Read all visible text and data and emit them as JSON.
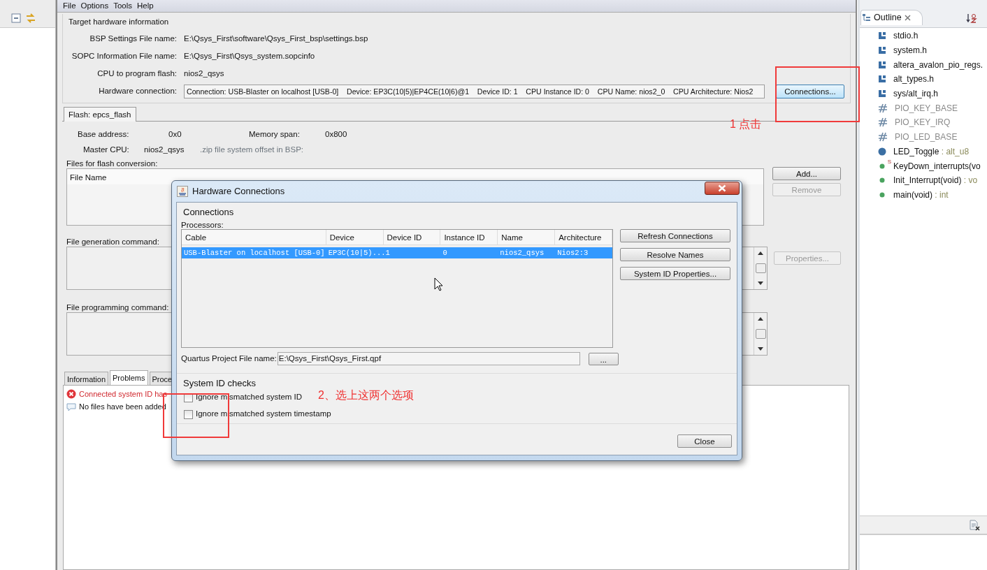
{
  "menu": [
    "File",
    "Options",
    "Tools",
    "Help"
  ],
  "target_hardware": {
    "title": "Target hardware information",
    "fields": [
      {
        "label": "BSP Settings File name:",
        "value": "E:\\Qsys_First\\software\\Qsys_First_bsp\\settings.bsp"
      },
      {
        "label": "SOPC Information File name:",
        "value": "E:\\Qsys_First\\Qsys_system.sopcinfo"
      },
      {
        "label": "CPU to program flash:",
        "value": "nios2_qsys"
      }
    ],
    "connection_label": "Hardware connection:",
    "connection_value": "Connection: USB-Blaster on localhost [USB-0]    Device: EP3C(10|5)|EP4CE(10|6)@1    Device ID: 1    CPU Instance ID: 0    CPU Name: nios2_0    CPU Architecture: Nios2",
    "connections_button": "Connections..."
  },
  "flash_tab": "Flash: epcs_flash",
  "flash": {
    "base_address_label": "Base address:",
    "base_address": "0x0",
    "memory_span_label": "Memory span:",
    "memory_span": "0x800",
    "master_cpu_label": "Master CPU:",
    "master_cpu": "nios2_qsys",
    "zip_label": ".zip file system offset in BSP:"
  },
  "files": {
    "label": "Files for flash conversion:",
    "columns": [
      "File Name"
    ],
    "buttons": [
      {
        "label": "Add...",
        "disabled": false
      },
      {
        "label": "Remove",
        "disabled": true
      }
    ]
  },
  "generation": {
    "label": "File generation command:",
    "button": {
      "label": "Properties...",
      "disabled": true
    }
  },
  "programming": {
    "label": "File programming command:"
  },
  "message_tabs": [
    {
      "label": "Information",
      "selected": false
    },
    {
      "label": "Problems",
      "selected": true
    },
    {
      "label": "Proce",
      "selected": false
    }
  ],
  "messages": [
    {
      "kind": "error",
      "text": "Connected system ID has"
    },
    {
      "kind": "info",
      "text": "No files have been added"
    }
  ],
  "dialog": {
    "title": "Hardware Connections",
    "section": "Connections",
    "processors_label": "Processors:",
    "columns": [
      "Cable",
      "Device",
      "Device ID",
      "Instance ID",
      "Name",
      "Architecture"
    ],
    "rows": [
      {
        "selected": true,
        "cells": [
          "USB-Blaster on localhost [USB-0]",
          "EP3C(10|5)...",
          "1",
          "0",
          "nios2_qsys",
          "Nios2:3"
        ]
      }
    ],
    "buttons": [
      "Refresh Connections",
      "Resolve Names",
      "System ID Properties..."
    ],
    "project_label": "Quartus Project File name:",
    "project_value": "E:\\Qsys_First\\Qsys_First.qpf",
    "browse_button": "...",
    "checks_title": "System ID checks",
    "checks": [
      {
        "label": "Ignore mismatched system ID",
        "checked": false
      },
      {
        "label": "Ignore mismatched system timestamp",
        "checked": false
      }
    ],
    "close_button": "Close"
  },
  "outline": {
    "title": "Outline",
    "items": [
      {
        "kind": "include",
        "name": "stdio.h"
      },
      {
        "kind": "include",
        "name": "system.h"
      },
      {
        "kind": "include",
        "name": "altera_avalon_pio_regs."
      },
      {
        "kind": "include",
        "name": "alt_types.h"
      },
      {
        "kind": "include",
        "name": "sys/alt_irq.h"
      },
      {
        "kind": "macro",
        "name": "PIO_KEY_BASE"
      },
      {
        "kind": "macro",
        "name": "PIO_KEY_IRQ"
      },
      {
        "kind": "macro",
        "name": "PIO_LED_BASE"
      },
      {
        "kind": "variable",
        "name": "LED_Toggle",
        "type": " : alt_u8"
      },
      {
        "kind": "function",
        "name": "KeyDown_interrupts(vo",
        "badge": "S"
      },
      {
        "kind": "function",
        "name": "Init_Interrupt(void)",
        "type": " : vo"
      },
      {
        "kind": "function",
        "name": "main(void)",
        "type": " : int"
      }
    ]
  },
  "annotations": [
    {
      "text": "1 点击"
    },
    {
      "text": "2、选上这两个选项"
    }
  ]
}
